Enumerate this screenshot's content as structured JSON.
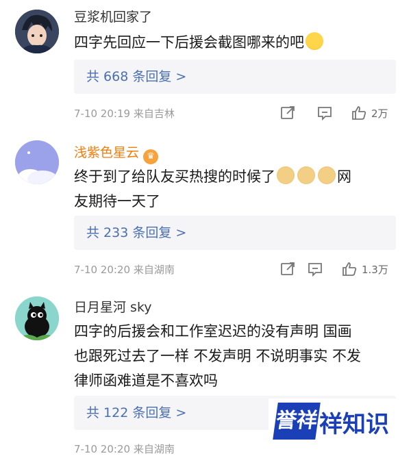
{
  "comments": [
    {
      "username": "豆浆机回家了",
      "text": "四字先回应一下后援会截图哪来的吧",
      "replies": "共 668 条回复 >",
      "time": "7-10 20:19",
      "location": "来自吉林",
      "likes": "2万",
      "emoji": "yum-emoji"
    },
    {
      "username": "浅紫色星云",
      "text_line1": "终于到了给队友买热搜的时候了",
      "text_tail": "网",
      "text_line2": "友期待一天了",
      "replies": "共 233 条回复 >",
      "time": "7-10 20:20",
      "location": "来自湖南",
      "likes": "1.3万",
      "badge_icon": "vip-badge-icon"
    },
    {
      "username": "日月星河 sky",
      "text_line1": "四字的后援会和工作室迟迟的没有声明 国画",
      "text_line2": "也跟死过去了一样 不发声明 不说明事实 不发",
      "text_line3": "律师函难道是不喜欢吗",
      "replies": "共 122 条回复 >",
      "time": "7-10 20:20",
      "location": "来自湖南"
    }
  ],
  "watermark": {
    "logo": "誉祥",
    "text": "祥知识"
  },
  "colors": {
    "vip_name": "#f27d0c",
    "reply_link": "#4a6fb0",
    "meta": "#9a9a9a"
  }
}
